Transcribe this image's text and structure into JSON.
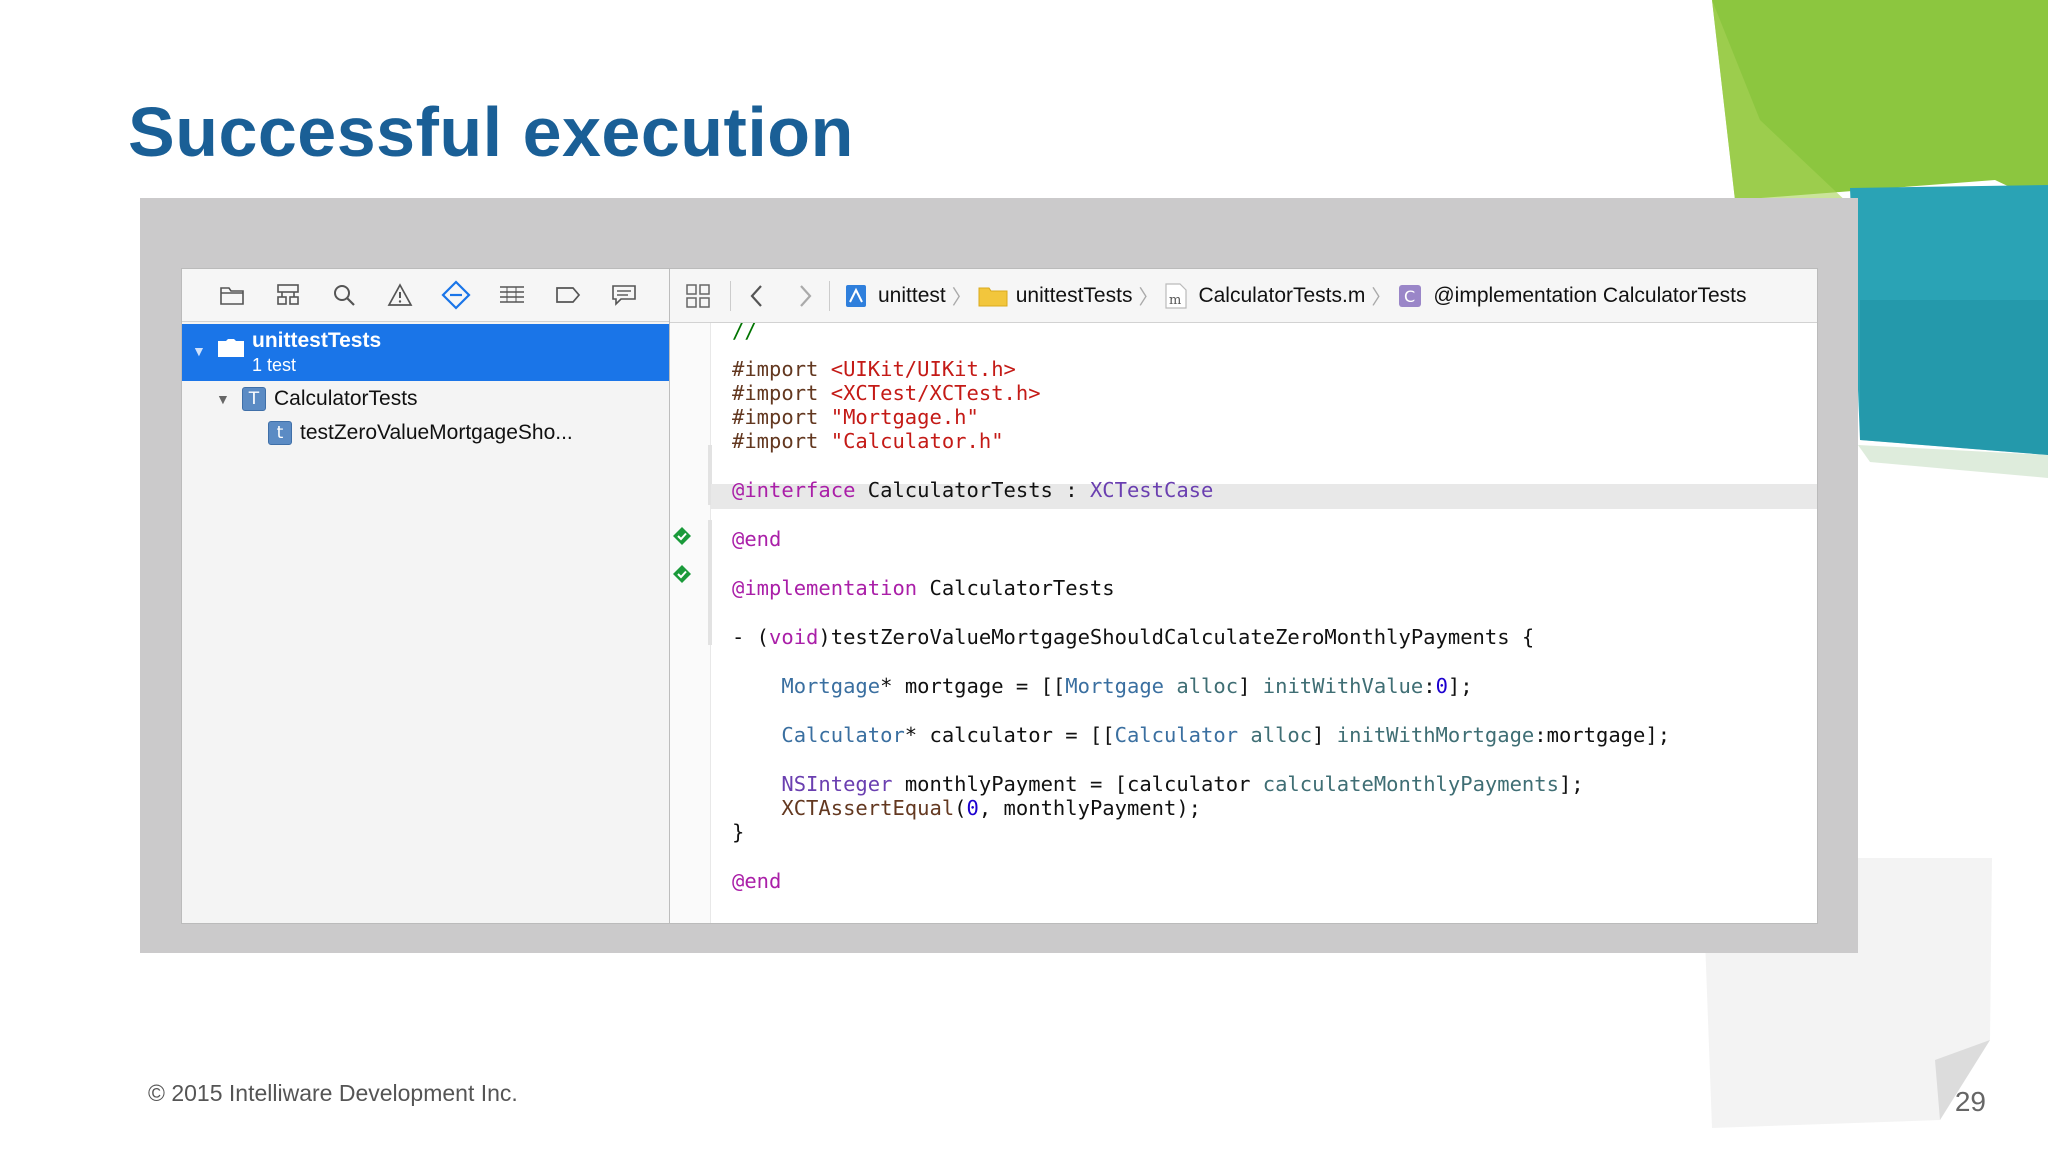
{
  "slide": {
    "title": "Successful execution",
    "copyright": "© 2015 Intelliware Development Inc.",
    "page_number": "29"
  },
  "navigator": {
    "toolbar_icons": [
      "folder-icon",
      "hierarchy-icon",
      "search-icon",
      "warning-icon",
      "test-navigator-icon",
      "debug-list-icon",
      "breakpoint-icon",
      "report-icon"
    ],
    "active_tab": "test-navigator-icon",
    "selected_item": {
      "name": "unittestTests",
      "subtitle": "1 test"
    },
    "items": [
      {
        "label": "CalculatorTests",
        "badge": "T",
        "status": ""
      },
      {
        "label": "testZeroValueMortgageSho...",
        "badge": "t",
        "status": "passed"
      }
    ]
  },
  "jump_bar": {
    "project": "unittest",
    "group": "unittestTests",
    "file": "CalculatorTests.m",
    "symbol": "@implementation CalculatorTests"
  },
  "code": {
    "comment": "//",
    "imports": [
      "<UIKit/UIKit.h>",
      "<XCTest/XCTest.h>",
      "\"Mortgage.h\"",
      "\"Calculator.h\""
    ],
    "interface_name": "CalculatorTests",
    "superclass": "XCTestCase",
    "implementation_name": "CalculatorTests",
    "method_name": "testZeroValueMortgageShouldCalculateZeroMonthlyPayments",
    "line1_var": "mortgage",
    "line1_class": "Mortgage",
    "line1_init": "initWithValue",
    "line1_value": "0",
    "line2_var": "calculator",
    "line2_class": "Calculator",
    "line2_init": "initWithMortgage",
    "line2_arg": "mortgage",
    "line3_type": "NSInteger",
    "line3_var": "monthlyPayment",
    "line3_receiver": "calculator",
    "line3_method": "calculateMonthlyPayments",
    "assert": "XCTAssertEqual",
    "assert_value": "0",
    "assert_var": "monthlyPayment"
  },
  "colors": {
    "title": "#1a5f96",
    "selection": "#1a75e8",
    "test_pass": "#1a9a3a",
    "keyword": "#aa1fa8",
    "string": "#c41a16"
  }
}
